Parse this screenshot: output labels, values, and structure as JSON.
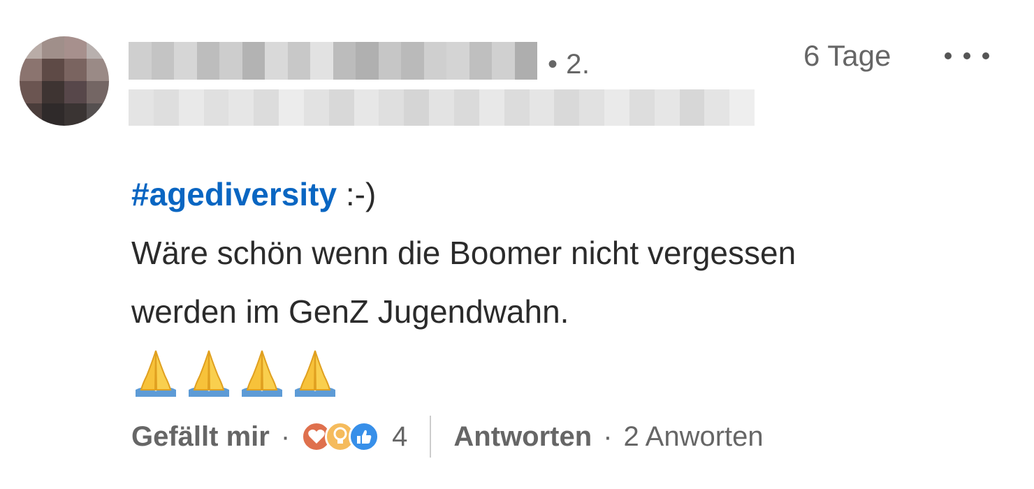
{
  "author": {
    "connection_degree": "• 2.",
    "timestamp": "6 Tage"
  },
  "comment": {
    "hashtag": "#agediversity",
    "emoticon": " :-)",
    "text_line_1": "Wäre schön wenn die Boomer nicht vergessen",
    "text_line_2": "werden im GenZ Jugendwahn.",
    "emoji_count": 4,
    "emoji_name": "folded-hands"
  },
  "actions": {
    "like_label": "Gefällt mir",
    "separator": "·",
    "reaction_icons": [
      "love-icon",
      "insightful-icon",
      "like-icon"
    ],
    "reaction_count": "4",
    "reply_label": "Antworten",
    "replies_count": "2 Anworten"
  },
  "colors": {
    "link_blue": "#0a66c2",
    "muted_text": "#666666",
    "body_text": "#2b2b2b",
    "love": "#df704d",
    "insightful": "#f5bb5c",
    "like": "#378fe9"
  }
}
